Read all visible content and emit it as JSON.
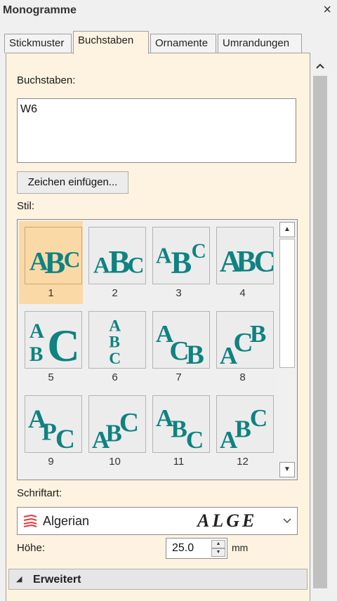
{
  "window": {
    "title": "Monogramme",
    "close_glyph": "×"
  },
  "tabs": [
    "Stickmuster",
    "Buchstaben",
    "Ornamente",
    "Umrandungen"
  ],
  "active_tab": "Buchstaben",
  "letters": {
    "label": "Buchstaben:",
    "value": "W6"
  },
  "insert_button": "Zeichen einfügen...",
  "style": {
    "label": "Stil:",
    "selected": "1",
    "items": [
      "1",
      "2",
      "3",
      "4",
      "5",
      "6",
      "7",
      "8",
      "9",
      "10",
      "11",
      "12"
    ],
    "glyph_color": "#0f8281",
    "selected_color": "#fbd9a6"
  },
  "font": {
    "label": "Schriftart:",
    "name": "Algerian",
    "preview": "ALGE",
    "icon": "font-type-icon",
    "icon_color": "#e23a3a"
  },
  "height": {
    "label": "Höhe:",
    "value": "25.0",
    "unit": "mm"
  },
  "advanced": {
    "label": "Erweitert",
    "arrow": "◢"
  },
  "scroll": {
    "up": "▲",
    "down": "▼"
  }
}
